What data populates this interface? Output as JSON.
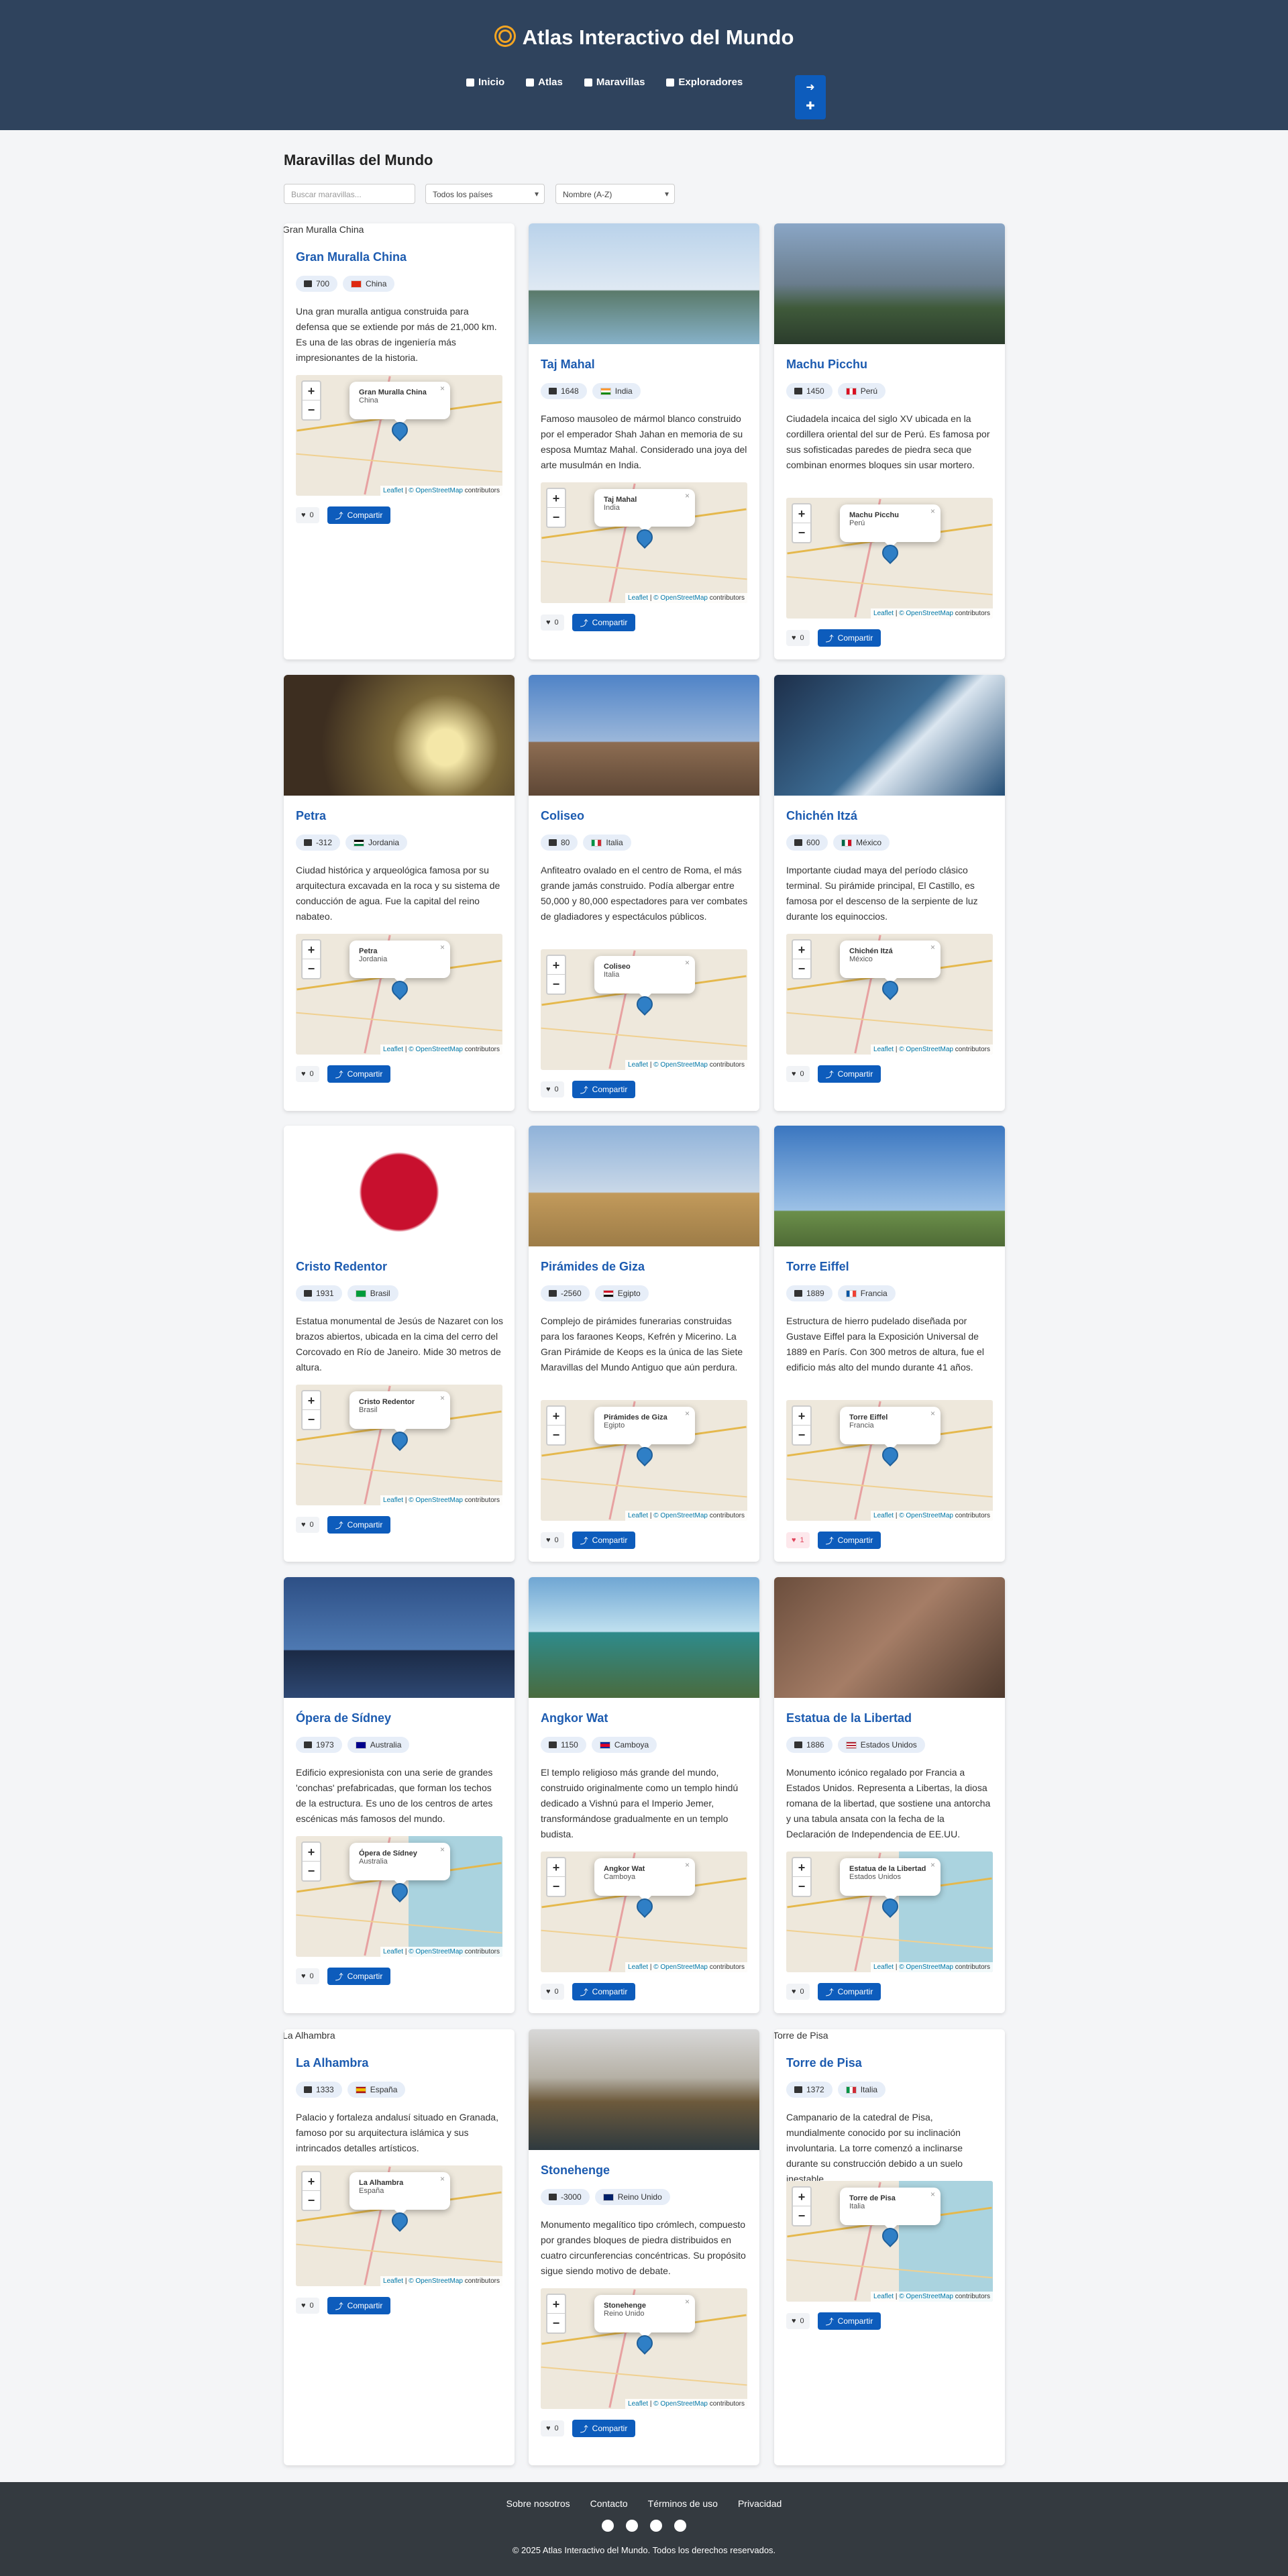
{
  "header": {
    "title": "Atlas Interactivo del Mundo",
    "nav": [
      "Inicio",
      "Atlas",
      "Maravillas",
      "Exploradores"
    ],
    "accent": "#2f435d",
    "button_color": "#0d5cbc"
  },
  "main": {
    "heading": "Maravillas del Mundo",
    "search_placeholder": "Buscar maravillas...",
    "country_filter": "Todos los países",
    "sort_filter": "Nombre (A-Z)"
  },
  "cards": [
    {
      "name": "Gran Muralla China",
      "year": "700",
      "country": "China",
      "desc": "Una gran muralla antigua construida para defensa que se extiende por más de 21,000 km. Es una de las obras de ingeniería más impresionantes de la historia.",
      "likes": "0",
      "broken_img": "Gran Muralla China"
    },
    {
      "name": "Taj Mahal",
      "year": "1648",
      "country": "India",
      "desc": "Famoso mausoleo de mármol blanco construido por el emperador Shah Jahan en memoria de su esposa Mumtaz Mahal. Considerado una joya del arte musulmán en India.",
      "likes": "0"
    },
    {
      "name": "Machu Picchu",
      "year": "1450",
      "country": "Perú",
      "desc": "Ciudadela incaica del siglo XV ubicada en la cordillera oriental del sur de Perú. Es famosa por sus sofisticadas paredes de piedra seca que combinan enormes bloques sin usar mortero.",
      "likes": "0"
    },
    {
      "name": "Petra",
      "year": "-312",
      "country": "Jordania",
      "desc": "Ciudad histórica y arqueológica famosa por su arquitectura excavada en la roca y su sistema de conducción de agua. Fue la capital del reino nabateo.",
      "likes": "0"
    },
    {
      "name": "Coliseo",
      "year": "80",
      "country": "Italia",
      "desc": "Anfiteatro ovalado en el centro de Roma, el más grande jamás construido. Podía albergar entre 50,000 y 80,000 espectadores para ver combates de gladiadores y espectáculos públicos.",
      "likes": "0"
    },
    {
      "name": "Chichén Itzá",
      "year": "600",
      "country": "México",
      "desc": "Importante ciudad maya del período clásico terminal. Su pirámide principal, El Castillo, es famosa por el descenso de la serpiente de luz durante los equinoccios.",
      "likes": "0"
    },
    {
      "name": "Cristo Redentor",
      "year": "1931",
      "country": "Brasil",
      "desc": "Estatua monumental de Jesús de Nazaret con los brazos abiertos, ubicada en la cima del cerro del Corcovado en Río de Janeiro. Mide 30 metros de altura.",
      "likes": "0"
    },
    {
      "name": "Pirámides de Giza",
      "year": "-2560",
      "country": "Egipto",
      "desc": "Complejo de pirámides funerarias construidas para los faraones Keops, Kefrén y Micerino. La Gran Pirámide de Keops es la única de las Siete Maravillas del Mundo Antiguo que aún perdura.",
      "likes": "0"
    },
    {
      "name": "Torre Eiffel",
      "year": "1889",
      "country": "Francia",
      "desc": "Estructura de hierro pudelado diseñada por Gustave Eiffel para la Exposición Universal de 1889 en París. Con 300 metros de altura, fue el edificio más alto del mundo durante 41 años.",
      "likes": "1"
    },
    {
      "name": "Ópera de Sídney",
      "year": "1973",
      "country": "Australia",
      "desc": "Edificio expresionista con una serie de grandes 'conchas' prefabricadas, que forman los techos de la estructura. Es uno de los centros de artes escénicas más famosos del mundo.",
      "likes": "0"
    },
    {
      "name": "Angkor Wat",
      "year": "1150",
      "country": "Camboya",
      "desc": "El templo religioso más grande del mundo, construido originalmente como un templo hindú dedicado a Vishnú para el Imperio Jemer, transformándose gradualmente en un templo budista.",
      "likes": "0"
    },
    {
      "name": "Estatua de la Libertad",
      "year": "1886",
      "country": "Estados Unidos",
      "desc": "Monumento icónico regalado por Francia a Estados Unidos. Representa a Libertas, la diosa romana de la libertad, que sostiene una antorcha y una tabula ansata con la fecha de la Declaración de Independencia de EE.UU.",
      "likes": "0"
    },
    {
      "name": "La Alhambra",
      "year": "1333",
      "country": "España",
      "desc": "Palacio y fortaleza andalusí situado en Granada, famoso por su arquitectura islámica y sus intrincados detalles artísticos.",
      "likes": "0",
      "broken_img": "La Alhambra"
    },
    {
      "name": "Stonehenge",
      "year": "-3000",
      "country": "Reino Unido",
      "desc": "Monumento megalítico tipo crómlech, compuesto por grandes bloques de piedra distribuidos en cuatro circunferencias concéntricas. Su propósito sigue siendo motivo de debate.",
      "likes": "0"
    },
    {
      "name": "Torre de Pisa",
      "year": "1372",
      "country": "Italia",
      "desc": "Campanario de la catedral de Pisa, mundialmente conocido por su inclinación involuntaria. La torre comenzó a inclinarse durante su construcción debido a un suelo inestable.",
      "likes": "0",
      "broken_img": "Torre de Pisa"
    }
  ],
  "map": {
    "attribution_leaflet": "Leaflet",
    "attribution_osm": "© OpenStreetMap",
    "attribution_tail": " contributors"
  },
  "share_label": "Compartir",
  "footer": {
    "links": [
      "Sobre nosotros",
      "Contacto",
      "Términos de uso",
      "Privacidad"
    ],
    "copyright": "© 2025 Atlas Interactivo del Mundo. Todos los derechos reservados."
  }
}
